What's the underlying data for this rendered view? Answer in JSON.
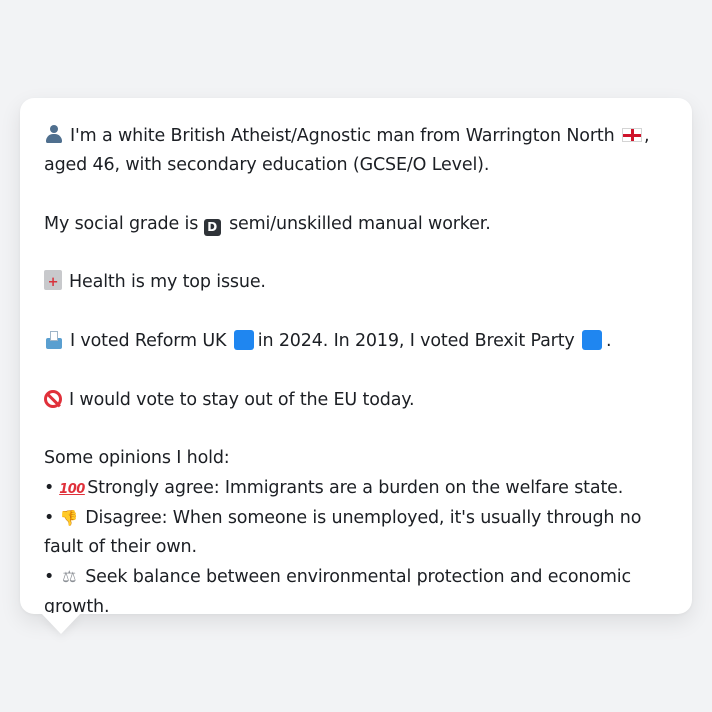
{
  "profile": {
    "intro": "I'm a white British Atheist/Agnostic man from Warrington North",
    "intro_end": ", aged 46, with secondary education (GCSE/O Level).",
    "grade_prefix": "My social grade is",
    "grade_letter": "D",
    "grade_suffix": "semi/unskilled manual worker.",
    "health": "Health is my top issue.",
    "vote_prefix": "I voted Reform UK",
    "vote_middle": "in 2024. In 2019, I voted Brexit Party",
    "vote_end": ".",
    "eu": "I would vote to stay out of the EU today.",
    "opinions_heading": "Some opinions I hold:",
    "opinions": [
      {
        "bullet": "•",
        "icon": "hundred-points-icon",
        "text": "Strongly agree: Immigrants are a burden on the welfare state."
      },
      {
        "bullet": "•",
        "icon": "thumbs-down-icon",
        "text": "Disagree: When someone is unemployed, it's usually through no fault of their own."
      },
      {
        "bullet": "•",
        "icon": "balance-scale-icon",
        "text": "Seek balance between environmental protection and economic growth."
      }
    ]
  },
  "icons": {
    "person": "person-silhouette-icon",
    "flag": "england-flag-icon",
    "hospital": "hospital-icon",
    "ballot": "ballot-box-icon",
    "party_color": "#1f86f0",
    "no_entry": "prohibited-icon"
  },
  "symbols": {
    "hundred": "100",
    "thumbs": "👎",
    "scales": "⚖"
  }
}
